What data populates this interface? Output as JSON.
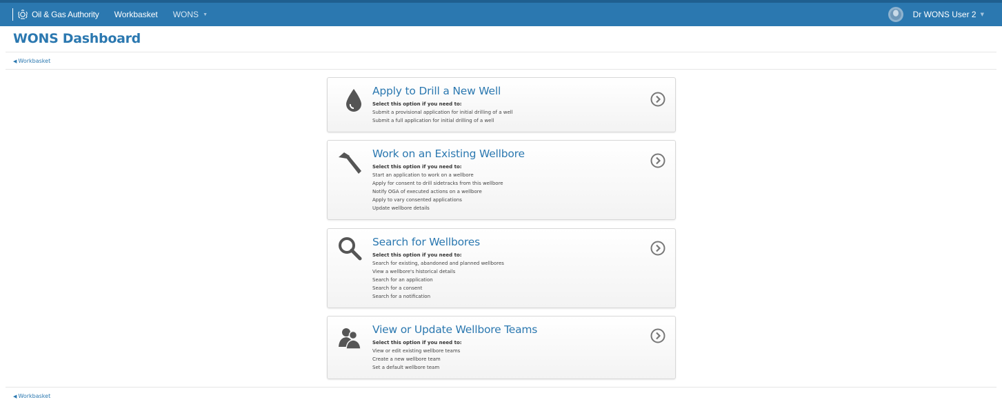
{
  "topbar": {
    "brand": "Oil & Gas Authority",
    "nav": [
      {
        "label": "Workbasket"
      },
      {
        "label": "WONS"
      }
    ],
    "user_name": "Dr WONS User 2"
  },
  "header": {
    "title": "WONS Dashboard",
    "back_label": "Workbasket"
  },
  "cards": [
    {
      "title": "Apply to Drill a New Well",
      "subtitle": "Select this option if you need to:",
      "items": [
        "Submit a provisional application for initial drilling of a well",
        "Submit a full application for initial drilling of a well"
      ],
      "icon": "drop-icon"
    },
    {
      "title": "Work on an Existing Wellbore",
      "subtitle": "Select this option if you need to:",
      "items": [
        "Start an application to work on a wellbore",
        "Apply for consent to drill sidetracks from this wellbore",
        "Notify OGA of executed actions on a wellbore",
        "Apply to vary consented applications",
        "Update wellbore details"
      ],
      "icon": "hammer-icon"
    },
    {
      "title": "Search for Wellbores",
      "subtitle": "Select this option if you need to:",
      "items": [
        "Search for existing, abandoned and planned wellbores",
        "View a wellbore's historical details",
        "Search for an application",
        "Search for a consent",
        "Search for a notification"
      ],
      "icon": "search-icon"
    },
    {
      "title": "View or Update Wellbore Teams",
      "subtitle": "Select this option if you need to:",
      "items": [
        "View or edit existing wellbore teams",
        "Create a new wellbore team",
        "Set a default wellbore team"
      ],
      "icon": "team-icon"
    }
  ],
  "footer": {
    "back_label": "Workbasket"
  },
  "colors": {
    "topbar": "#2b78b0",
    "link": "#2b78b0",
    "icon": "#555555"
  }
}
